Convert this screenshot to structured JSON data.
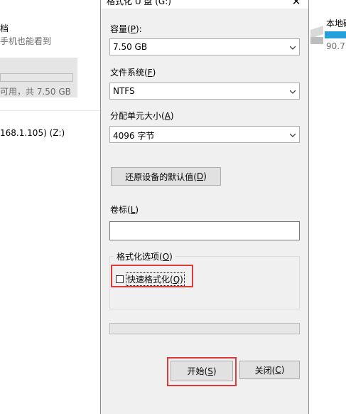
{
  "background": {
    "left_texts": {
      "line1": "档",
      "line2": "手机也能看到",
      "capacity": "可用，共 7.50 GB",
      "network": "168.1.105) (Z:)"
    },
    "right_texts": {
      "drive_name": "本地磁",
      "drive_free": "90.7"
    },
    "colors": {
      "accent": "#26a0da"
    }
  },
  "dialog": {
    "title": "格式化 U 盘 (G:)",
    "capacity": {
      "label_prefix": "容量(",
      "mnemonic": "P",
      "label_suffix": "):",
      "value": "7.50 GB"
    },
    "filesystem": {
      "label_prefix": "文件系统(",
      "mnemonic": "F",
      "label_suffix": ")",
      "value": "NTFS"
    },
    "allocation": {
      "label_prefix": "分配单元大小(",
      "mnemonic": "A",
      "label_suffix": ")",
      "value": "4096 字节"
    },
    "restore_defaults": {
      "prefix": "还原设备的默认值(",
      "mnemonic": "D",
      "suffix": ")"
    },
    "volume_label": {
      "label_prefix": "卷标(",
      "mnemonic": "L",
      "label_suffix": ")",
      "value": ""
    },
    "format_options": {
      "title_prefix": "格式化选项(",
      "mnemonic": "O",
      "title_suffix": ")",
      "quick_format": {
        "prefix": "快速格式化(",
        "mnemonic": "Q",
        "suffix": ")",
        "checked": false
      }
    },
    "progress": 0,
    "start_button": {
      "prefix": "开始(",
      "mnemonic": "S",
      "suffix": ")"
    },
    "close_button": {
      "prefix": "关闭(",
      "mnemonic": "C",
      "suffix": ")"
    },
    "close_icon": "close-icon",
    "highlight_color": "#d93a3a"
  }
}
